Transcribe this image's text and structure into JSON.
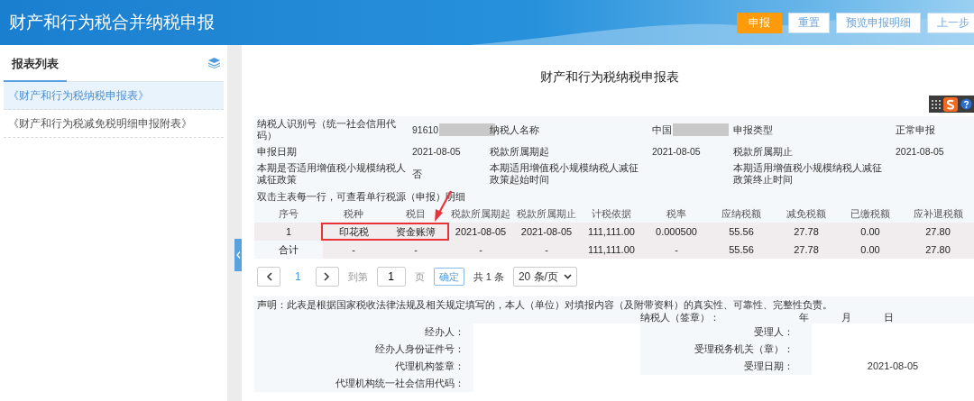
{
  "header": {
    "title": "财产和行为税合并纳税申报",
    "buttons": [
      {
        "label": "申报",
        "primary": true
      },
      {
        "label": "重置",
        "primary": false
      },
      {
        "label": "预览申报明细",
        "primary": false
      },
      {
        "label": "上一步",
        "primary": false
      }
    ]
  },
  "sidebar": {
    "title": "报表列表",
    "items": [
      {
        "label": "《财产和行为税纳税申报表》",
        "selected": true
      },
      {
        "label": "《财产和行为税减免税明细申报附表》",
        "selected": false
      }
    ]
  },
  "form": {
    "title": "财产和行为税纳税申报表",
    "info_rows": [
      [
        "纳税人识别号（统一社会信用代码）",
        {
          "text": "91610",
          "redacted": true
        },
        "纳税人名称",
        {
          "text": "中国",
          "redacted": true
        },
        "申报类型",
        "正常申报"
      ],
      [
        "申报日期",
        "2021-08-05",
        "税款所属期起",
        "2021-08-05",
        "税款所属期止",
        "2021-08-05"
      ],
      [
        "本期是否适用增值税小规模纳税人减征政策",
        "否",
        "本期适用增值税小规模纳税人减征政策起始时间",
        null,
        "本期适用增值税小规模纳税人减征政策终止时间",
        null
      ]
    ],
    "note": "双击主表每一行，可查看单行税源（申报）明细",
    "table": {
      "columns": [
        "序号",
        "税种",
        "税目",
        "税款所属期起",
        "税款所属期止",
        "计税依据",
        "税率",
        "应纳税额",
        "减免税额",
        "已缴税额",
        "应补退税额"
      ],
      "rows": [
        {
          "kind": "item",
          "cells": [
            "1",
            {
              "text": "印花税",
              "boxed": true
            },
            {
              "text": "资金账簿",
              "boxed": true
            },
            "2021-08-05",
            "2021-08-05",
            "111,111.00",
            "0.000500",
            "55.56",
            "27.78",
            "0.00",
            "27.80"
          ]
        },
        {
          "kind": "total",
          "cells": [
            "合计",
            "-",
            "-",
            "-",
            "-",
            "111,111.00",
            "-",
            "55.56",
            "27.78",
            "0.00",
            "27.80"
          ]
        }
      ]
    },
    "pagination": {
      "current_page": "1",
      "goto_label": "到第",
      "goto_value": "1",
      "page_unit": "页",
      "confirm": "确定",
      "total": "共 1 条",
      "page_size": "20 条/页"
    },
    "declaration": {
      "statement": "声明：此表是根据国家税收法律法规及相关规定填写的，本人（单位）对填报内容（及附带资料）的真实性、可靠性、完整性负责。",
      "signer_label": "纳税人（签章）：",
      "date_parts": [
        "年",
        "月",
        "日"
      ],
      "rows": [
        {
          "left_label": "经办人：",
          "right_label": "受理人："
        },
        {
          "left_label": "经办人身份证件号：",
          "right_label": "受理税务机关（章）："
        },
        {
          "left_label": "代理机构签章：",
          "right_label": "受理日期：",
          "right_value": "2021-08-05"
        },
        {
          "left_label": "代理机构统一社会信用代码："
        }
      ]
    }
  }
}
